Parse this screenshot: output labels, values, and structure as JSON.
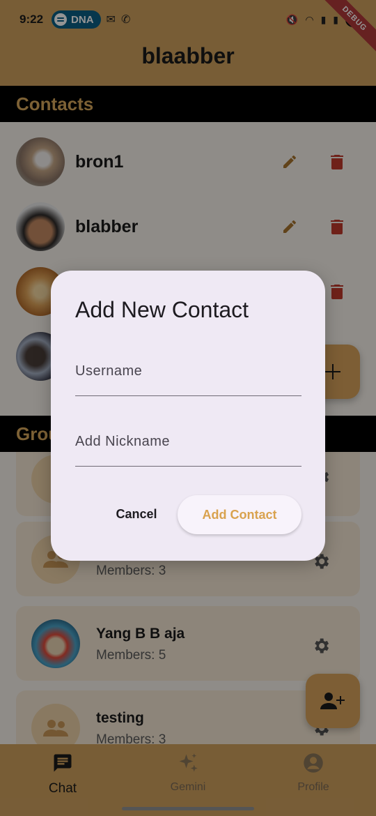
{
  "status_bar": {
    "time": "9:22",
    "carrier_badge": "DNA",
    "debug_banner": "DEBUG",
    "battery": "",
    "icons": [
      "spotify-icon",
      "gmail-icon",
      "whatsapp-icon",
      "mute-icon",
      "wifi-icon",
      "signal-icon",
      "battery-icon"
    ]
  },
  "app_bar": {
    "title": "blaabber"
  },
  "contacts": {
    "heading": "Contacts",
    "items": [
      {
        "name": "bron1"
      },
      {
        "name": "blabber"
      },
      {
        "name": ""
      },
      {
        "name": ""
      }
    ]
  },
  "groups": {
    "heading": "Grou",
    "items": [
      {
        "name": "",
        "members": ""
      },
      {
        "name": "",
        "members": "Members: 3"
      },
      {
        "name": "Yang B B aja",
        "members": "Members: 5"
      },
      {
        "name": "testing",
        "members": "Members: 3"
      }
    ]
  },
  "dialog": {
    "title": "Add New Contact",
    "username_placeholder": "Username",
    "username_value": "",
    "nickname_placeholder": "Add Nickname",
    "nickname_value": "",
    "cancel_label": "Cancel",
    "add_label": "Add Contact"
  },
  "bottom_nav": {
    "items": [
      {
        "label": "Chat",
        "icon": "chat-icon",
        "active": true
      },
      {
        "label": "Gemini",
        "icon": "sparkle-icon",
        "active": false
      },
      {
        "label": "Profile",
        "icon": "profile-icon",
        "active": false
      }
    ]
  },
  "colors": {
    "primary": "#cfa15e",
    "section_heading": "#d8a85c",
    "delete": "#c0392b",
    "edit": "#a8742e",
    "dialog_bg": "#efe9f4",
    "accent_text": "#d9a24e"
  }
}
